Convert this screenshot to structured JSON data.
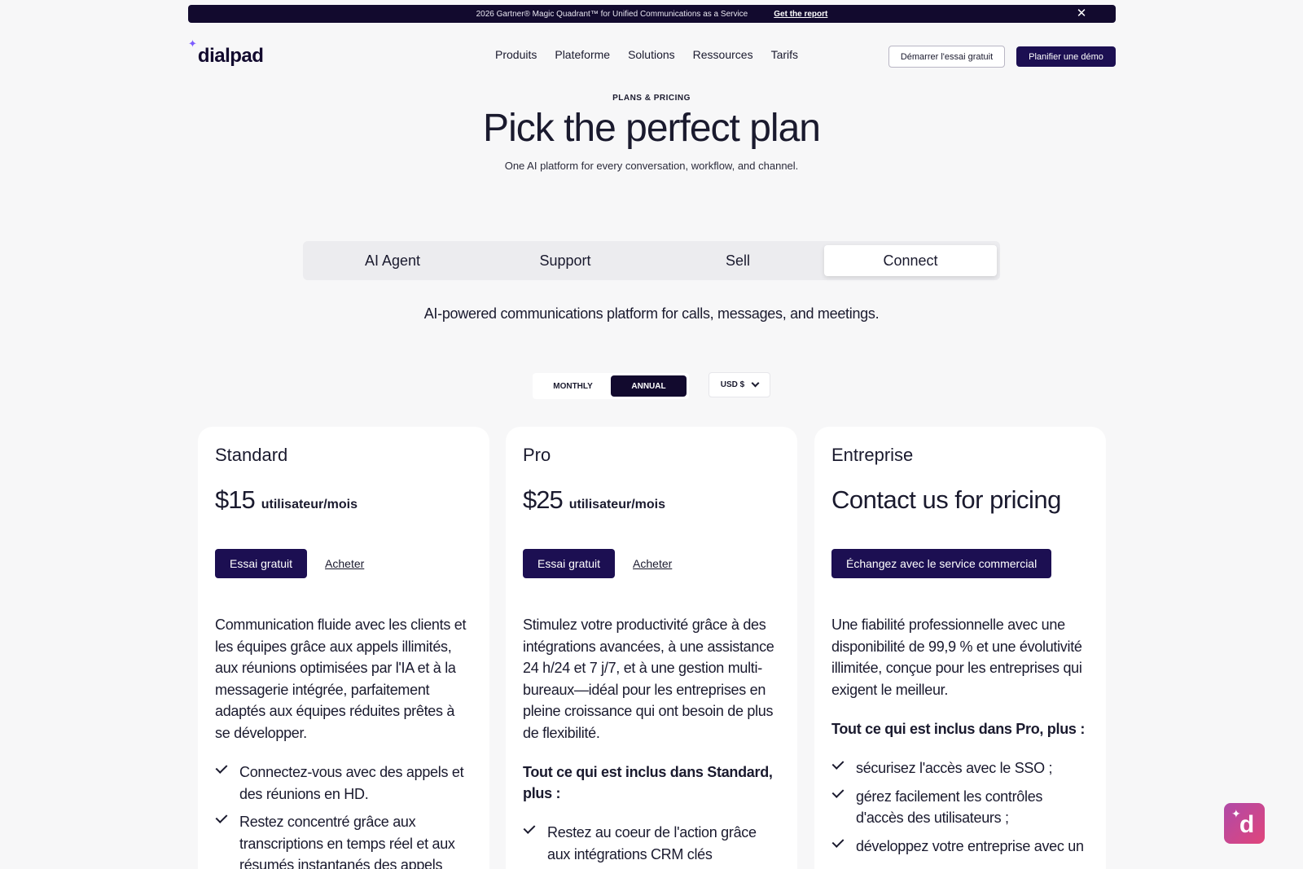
{
  "banner": {
    "text": "2026 Gartner® Magic Quadrant™ for Unified Communications as a Service",
    "link": "Get the report",
    "close": "✕"
  },
  "header": {
    "logo": "dialpad",
    "nav": [
      "Produits",
      "Plateforme",
      "Solutions",
      "Ressources",
      "Tarifs"
    ],
    "trial_button": "Démarrer l'essai gratuit",
    "demo_button": "Planifier une démo"
  },
  "hero": {
    "eyebrow": "PLANS & PRICING",
    "title": "Pick the perfect plan",
    "subtitle": "One AI platform for every conversation, workflow, and channel."
  },
  "tabs": {
    "items": [
      "AI Agent",
      "Support",
      "Sell",
      "Connect"
    ],
    "active": "Connect",
    "description": "AI-powered communications platform for calls, messages, and meetings."
  },
  "billing": {
    "monthly": "MONTHLY",
    "annual": "ANNUAL",
    "selected": "ANNUAL",
    "currency": "USD $"
  },
  "plans": [
    {
      "name": "Standard",
      "price": "$15",
      "unit": "utilisateur/mois",
      "trial": "Essai gratuit",
      "buy": "Acheter",
      "description": "Communication fluide avec les clients et les équipes grâce aux appels illimités, aux réunions optimisées par l'IA et à la messagerie intégrée, parfaitement adaptés aux équipes réduites prêtes à se développer.",
      "features": [
        "Connectez-vous avec des appels et des réunions en HD.",
        "Restez concentré grâce aux transcriptions en temps réel et aux résumés instantanés des appels"
      ]
    },
    {
      "name": "Pro",
      "price": "$25",
      "unit": "utilisateur/mois",
      "trial": "Essai gratuit",
      "buy": "Acheter",
      "description": "Stimulez votre productivité grâce à des intégrations avancées, à une assistance 24 h/24 et 7 j/7, et à une gestion multi-bureaux—idéal pour les entreprises en pleine croissance qui ont besoin de plus de flexibilité.",
      "includes": "Tout ce qui est inclus dans Standard, plus  :",
      "features": [
        "Restez au coeur de l'action grâce aux intégrations CRM clés"
      ]
    },
    {
      "name": "Entreprise",
      "contact": "Contact us for pricing",
      "sales": "Échangez avec le service commercial",
      "description": "Une fiabilité professionnelle avec une disponibilité de 99,9 % et une évolutivité illimitée, conçue pour les entreprises qui exigent le meilleur.",
      "includes": "Tout ce qui est inclus dans Pro, plus :",
      "features": [
        "sécurisez l'accès avec le SSO ;",
        "gérez facilement les contrôles d'accès des utilisateurs ;",
        "développez votre entreprise avec un"
      ]
    }
  ],
  "chat": {
    "icon": "dialpad-assistant-icon",
    "letter": "d",
    "spark": "✦"
  },
  "colors": {
    "brand_dark": "#1c0f52",
    "banner": "#120a2e",
    "background": "#f7f7f8",
    "fab": "#e0457b"
  }
}
